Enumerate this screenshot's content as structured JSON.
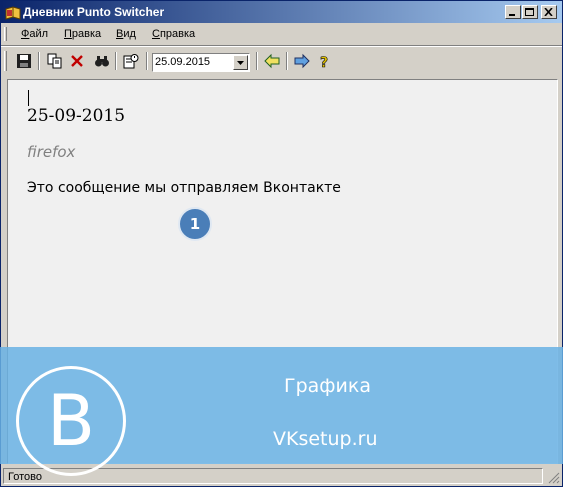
{
  "window": {
    "title": "Дневник Punto Switcher",
    "controls": [
      "minimize-icon",
      "maximize-icon",
      "close-icon"
    ]
  },
  "menu": {
    "items": [
      {
        "accel": "Ф",
        "rest": "айл"
      },
      {
        "accel": "П",
        "rest": "равка"
      },
      {
        "accel": "В",
        "rest": "ид"
      },
      {
        "accel": "С",
        "rest": "правка"
      }
    ]
  },
  "toolbar": {
    "icons": [
      "save-icon",
      "copy-icon",
      "delete-icon",
      "find-icon",
      "calendar-icon",
      "back-icon",
      "forward-icon",
      "help-icon"
    ],
    "date_value": "25.09.2015"
  },
  "diary": {
    "date_heading": "25-09-2015",
    "app_name": "firefox",
    "message": "Это сообщение мы отправляем Вконтакте"
  },
  "annotation": {
    "marker": "1"
  },
  "status": {
    "text": "Готово"
  },
  "overlay": {
    "logo_letter": "B",
    "category": "Графика",
    "site": "VKsetup.ru",
    "color": "#68b2e4"
  }
}
